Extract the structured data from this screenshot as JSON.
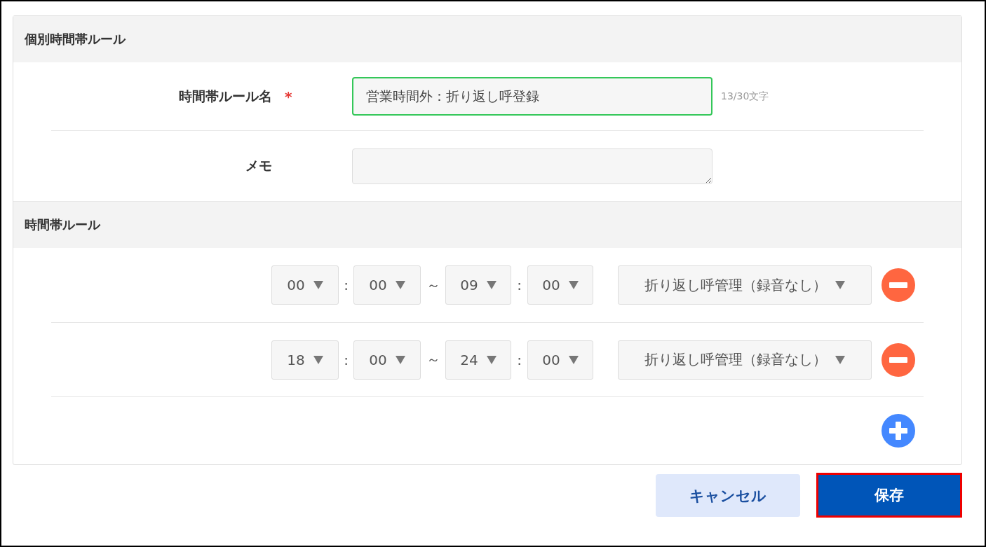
{
  "rule_info": {
    "title": "個別時間帯ルール",
    "fields": [
      {
        "kind": "text",
        "label": "時間帯ルール名",
        "required_mark": "*",
        "value": "営業時間外：折り返し呼登録",
        "counter": "13/30文字",
        "focused": true
      },
      {
        "kind": "textarea",
        "label": "メモ",
        "focused": false
      }
    ]
  },
  "time_rules": {
    "title": "時間帯ルール",
    "rules": [
      {
        "start_hour": "00",
        "sep1": ":",
        "start_minute": "00",
        "range": "～",
        "end_hour": "09",
        "sep2": ":",
        "end_minute": "00",
        "action": "折り返し呼管理（録音なし）"
      },
      {
        "start_hour": "18",
        "sep1": ":",
        "start_minute": "00",
        "range": "～",
        "end_hour": "24",
        "sep2": ":",
        "end_minute": "00",
        "action": "折り返し呼管理（録音なし）"
      }
    ]
  },
  "buttons": [
    {
      "kind": "secondary",
      "label": "キャンセル",
      "highlighted": false
    },
    {
      "kind": "primary",
      "label": "保存",
      "highlighted": true
    }
  ]
}
